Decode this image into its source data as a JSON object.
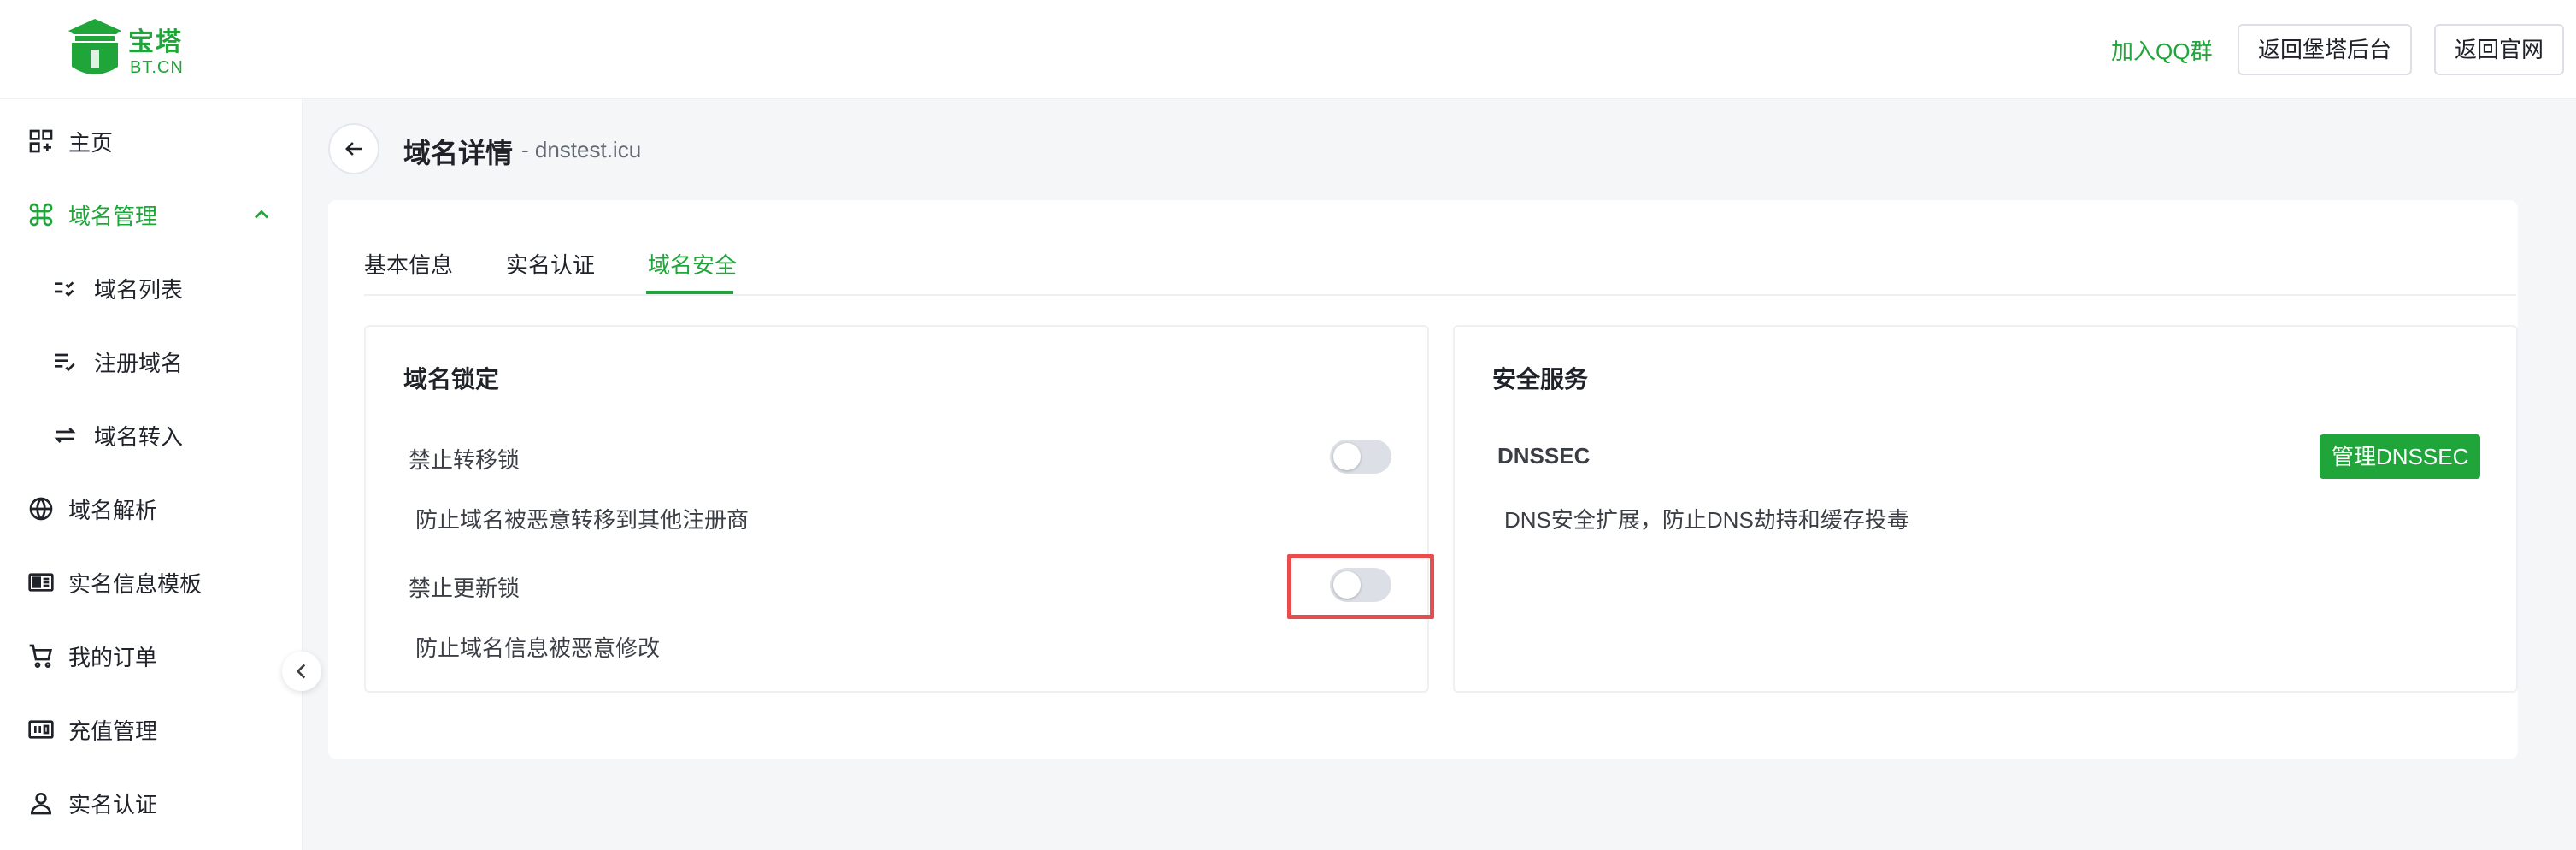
{
  "brand": {
    "name_cn": "宝塔",
    "name_en": "BT.CN",
    "color": "#20a53a"
  },
  "header": {
    "join_qq": "加入QQ群",
    "back_panel": "返回堡塔后台",
    "back_official": "返回官网"
  },
  "sidebar": {
    "items": [
      {
        "label": "主页",
        "icon": "dashboard-icon"
      },
      {
        "label": "域名管理",
        "icon": "command-icon",
        "active": true
      },
      {
        "label": "域名列表",
        "icon": "list-check-icon"
      },
      {
        "label": "注册域名",
        "icon": "list-add-icon"
      },
      {
        "label": "域名转入",
        "icon": "transfer-icon"
      },
      {
        "label": "域名解析",
        "icon": "globe-icon"
      },
      {
        "label": "实名信息模板",
        "icon": "id-card-icon"
      },
      {
        "label": "我的订单",
        "icon": "cart-icon"
      },
      {
        "label": "充值管理",
        "icon": "recharge-icon"
      },
      {
        "label": "实名认证",
        "icon": "user-icon"
      }
    ]
  },
  "page": {
    "title": "域名详情",
    "subtitle": "- dnstest.icu"
  },
  "tabs": [
    {
      "label": "基本信息"
    },
    {
      "label": "实名认证"
    },
    {
      "label": "域名安全",
      "active": true
    }
  ],
  "lock_panel": {
    "title": "域名锁定",
    "transfer_lock": {
      "label": "禁止转移锁",
      "desc": "防止域名被恶意转移到其他注册商",
      "enabled": false
    },
    "update_lock": {
      "label": "禁止更新锁",
      "desc": "防止域名信息被恶意修改",
      "enabled": false
    }
  },
  "security_panel": {
    "title": "安全服务",
    "dnssec": {
      "label": "DNSSEC",
      "desc": "DNS安全扩展，防止DNS劫持和缓存投毒",
      "button": "管理DNSSEC"
    }
  }
}
